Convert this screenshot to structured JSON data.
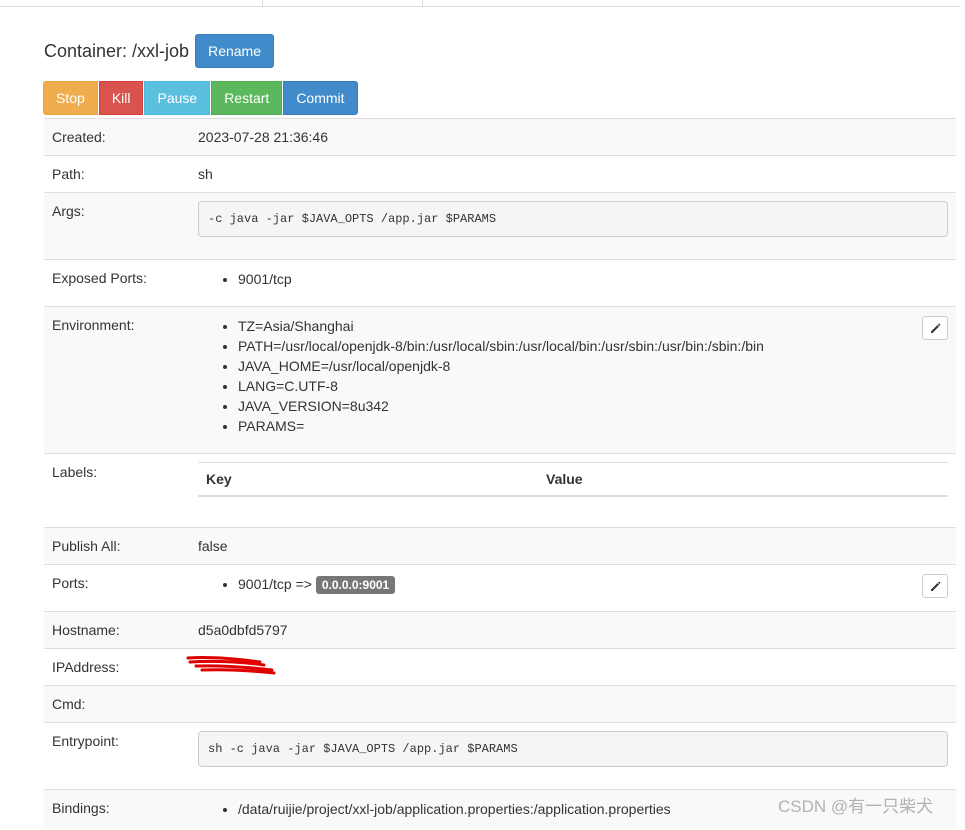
{
  "page": {
    "title": "Container: /xxl-job",
    "rename_label": "Rename"
  },
  "actions": {
    "stop": "Stop",
    "kill": "Kill",
    "pause": "Pause",
    "restart": "Restart",
    "commit": "Commit"
  },
  "fields": {
    "created": {
      "label": "Created:",
      "value": "2023-07-28 21:36:46"
    },
    "path": {
      "label": "Path:",
      "value": "sh"
    },
    "args": {
      "label": "Args:",
      "value": "-c java -jar $JAVA_OPTS /app.jar $PARAMS"
    },
    "exposed_ports": {
      "label": "Exposed Ports:",
      "items": [
        "9001/tcp"
      ]
    },
    "environment": {
      "label": "Environment:",
      "items": [
        "TZ=Asia/Shanghai",
        "PATH=/usr/local/openjdk-8/bin:/usr/local/sbin:/usr/local/bin:/usr/sbin:/usr/bin:/sbin:/bin",
        "JAVA_HOME=/usr/local/openjdk-8",
        "LANG=C.UTF-8",
        "JAVA_VERSION=8u342",
        "PARAMS="
      ]
    },
    "labels": {
      "label": "Labels:",
      "key_header": "Key",
      "value_header": "Value"
    },
    "publish_all": {
      "label": "Publish All:",
      "value": "false"
    },
    "ports": {
      "label": "Ports:",
      "mapping": "9001/tcp =>",
      "host": "0.0.0.0:9001"
    },
    "hostname": {
      "label": "Hostname:",
      "value": "d5a0dbfd5797"
    },
    "ipaddress": {
      "label": "IPAddress:"
    },
    "cmd": {
      "label": "Cmd:"
    },
    "entrypoint": {
      "label": "Entrypoint:",
      "value": "sh -c java -jar $JAVA_OPTS /app.jar $PARAMS"
    },
    "bindings": {
      "label": "Bindings:",
      "items": [
        "/data/ruijie/project/xxl-job/application.properties:/application.properties"
      ]
    }
  },
  "icons": {
    "edit": "pencil-icon"
  },
  "colors": {
    "primary": "#428bca",
    "warning": "#f0ad4e",
    "danger": "#d9534f",
    "info": "#5bc0de",
    "success": "#5cb85c",
    "badge": "#777777"
  },
  "watermark": "CSDN @有一只柴犬"
}
